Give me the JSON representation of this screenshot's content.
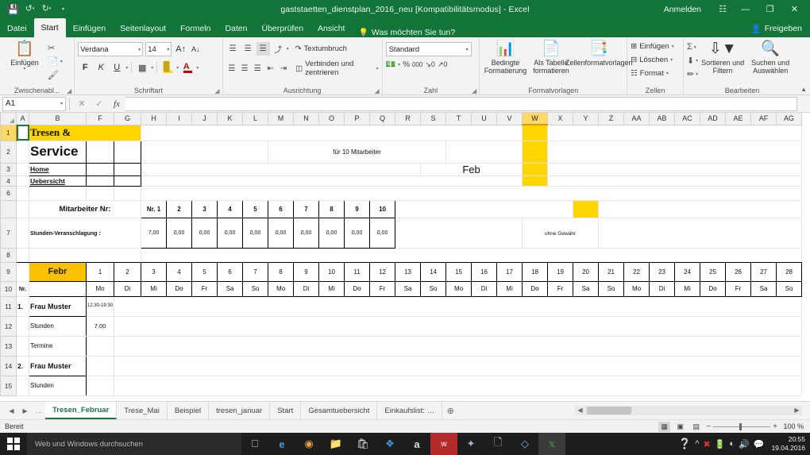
{
  "window": {
    "title": "gaststaetten_dienstplan_2016_neu [Kompatibilitätsmodus] - Excel",
    "signin": "Anmelden",
    "minimize": "—",
    "restore": "❐",
    "close": "✕",
    "qat": [
      "save-icon",
      "undo-icon",
      "redo-icon",
      "customize-icon"
    ]
  },
  "ribbon": {
    "tabs": [
      {
        "label": "Datei",
        "active": false
      },
      {
        "label": "Start",
        "active": true
      },
      {
        "label": "Einfügen",
        "active": false
      },
      {
        "label": "Seitenlayout",
        "active": false
      },
      {
        "label": "Formeln",
        "active": false
      },
      {
        "label": "Daten",
        "active": false
      },
      {
        "label": "Überprüfen",
        "active": false
      },
      {
        "label": "Ansicht",
        "active": false
      }
    ],
    "tellme": "Was möchten Sie tun?",
    "share": "Freigeben",
    "groups": {
      "clipboard": {
        "label": "Zwischenabl...",
        "paste": "Einfügen",
        "cut": "Ausschneiden",
        "copy": "Kopieren",
        "format_painter": "Format übertragen"
      },
      "font": {
        "label": "Schriftart",
        "font_name": "Verdana",
        "font_size": "14",
        "bold": "F",
        "italic": "K",
        "underline": "U"
      },
      "alignment": {
        "label": "Ausrichtung",
        "wrap_text": "Textumbruch",
        "merge_center": "Verbinden und zentrieren"
      },
      "number": {
        "label": "Zahl",
        "format": "Standard",
        "percent": "%",
        "thousands": "000"
      },
      "styles": {
        "label": "Formatvorlagen",
        "conditional": "Bedingte Formatierung",
        "as_table": "Als Tabelle formatieren",
        "cell_styles": "Zellenformatvorlagen"
      },
      "cells": {
        "label": "Zellen",
        "insert": "Einfügen",
        "delete": "Löschen",
        "format": "Format"
      },
      "editing": {
        "label": "Bearbeiten",
        "sort_filter": "Sortieren und Filtern",
        "find_select": "Suchen und Auswählen",
        "autosum": "Σ"
      }
    }
  },
  "formula_bar": {
    "name_box": "A1",
    "formula": "",
    "cancel": "✕",
    "accept": "✓",
    "fx": "fx"
  },
  "grid": {
    "columns": [
      "A",
      "B",
      "F",
      "G",
      "H",
      "I",
      "J",
      "K",
      "L",
      "M",
      "N",
      "O",
      "P",
      "Q",
      "R",
      "S",
      "T",
      "U",
      "V",
      "W",
      "X",
      "Y",
      "Z",
      "AA",
      "AB",
      "AC",
      "AD",
      "AE",
      "AF",
      "AG"
    ],
    "selected_column": "W",
    "row_numbers": [
      "1",
      "2",
      "3",
      "4",
      "6",
      "7",
      "8",
      "9",
      "10",
      "11",
      "12",
      "13",
      "14",
      "15"
    ],
    "selected_cell": "A1",
    "header_block": {
      "tresen": "Tresen     &",
      "service": "Service",
      "home": "Home",
      "uebersicht": "Uebersicht",
      "fuer_mitarbeiter": "für 10 Mitarbeiter",
      "feb": "Feb"
    },
    "staff_block": {
      "label": "Mitarbeiter Nr:",
      "numbers": [
        "Nr. 1",
        "2",
        "3",
        "4",
        "5",
        "6",
        "7",
        "8",
        "9",
        "10"
      ],
      "hours_label": "Stunden-Veranschlagung :",
      "hours": [
        "7,00",
        "0,00",
        "0,00",
        "0,00",
        "0,00",
        "0,00",
        "0,00",
        "0,00",
        "0,00",
        "0,00"
      ],
      "disclaimer": "ohne Gewähr"
    },
    "calendar": {
      "month_label": "Febr",
      "nr_label": "Nr.",
      "days": [
        1,
        2,
        3,
        4,
        5,
        6,
        7,
        8,
        9,
        10,
        11,
        12,
        13,
        14,
        15,
        16,
        17,
        18,
        19,
        20,
        21,
        22,
        23,
        24,
        25,
        26,
        27,
        28
      ],
      "weekdays": [
        "Mo",
        "Di",
        "Mi",
        "Do",
        "Fr",
        "Sa",
        "So",
        "Mo",
        "Di",
        "Mi",
        "Do",
        "Fr",
        "Sa",
        "So",
        "Mo",
        "Di",
        "Mi",
        "Do",
        "Fr",
        "Sa",
        "So",
        "Mo",
        "Di",
        "Mi",
        "Do",
        "Fr",
        "Sa",
        "So"
      ],
      "weekend_color": "#d01a1a"
    },
    "rows": [
      {
        "nr": "1.",
        "name": "Frau Muster",
        "shift": "12:30-19:30"
      },
      {
        "nr": "",
        "name": "Stunden",
        "shift": "7,00"
      },
      {
        "nr": "",
        "name": "Termine",
        "shift": ""
      },
      {
        "nr": "2.",
        "name": "Frau Muster",
        "shift": ""
      },
      {
        "nr": "",
        "name": "Stunden",
        "shift": ""
      }
    ]
  },
  "sheet_tabs": {
    "nav": [
      "◀",
      "▶",
      "…"
    ],
    "tabs": [
      {
        "label": "Tresen_Februar",
        "active": true
      },
      {
        "label": "Trese_Mai",
        "active": false
      },
      {
        "label": "Beispiel",
        "active": false
      },
      {
        "label": "tresen_januar",
        "active": false
      },
      {
        "label": "Start",
        "active": false
      },
      {
        "label": "Gesamtuebersicht",
        "active": false
      },
      {
        "label": "Einkaufslist: …",
        "active": false
      }
    ],
    "add": "⊕"
  },
  "status_bar": {
    "ready": "Bereit",
    "zoom": "100 %",
    "zoom_out": "−",
    "zoom_in": "+",
    "views": [
      "normal-view-icon",
      "page-layout-icon",
      "page-break-icon"
    ]
  },
  "taskbar": {
    "search_placeholder": "Web und Windows durchsuchen",
    "icons": [
      "task-view-icon",
      "edge-icon",
      "chrome-icon",
      "file-explorer-icon",
      "store-icon",
      "dropbox-icon",
      "amazon-icon",
      "wunderlist-icon",
      "app-icon",
      "pdf-icon",
      "vlc-icon",
      "excel-icon"
    ],
    "tray": [
      "help-icon",
      "show-hidden-icon",
      "avira-icon",
      "battery-icon",
      "wifi-icon",
      "volume-icon",
      "action-center-icon"
    ],
    "time": "20:55",
    "date": "19.04.2016"
  }
}
